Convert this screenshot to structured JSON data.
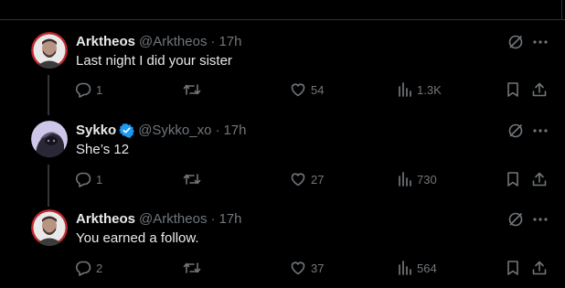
{
  "posts": [
    {
      "name": "Arktheos",
      "handle": "@Arktheos",
      "dot": "·",
      "time": "17h",
      "text": "Last night I did your sister",
      "verified": false,
      "replies": "1",
      "likes": "54",
      "views": "1.3K"
    },
    {
      "name": "Sykko",
      "handle": "@Sykko_xo",
      "dot": "·",
      "time": "17h",
      "text": "She’s 12",
      "verified": true,
      "replies": "1",
      "likes": "27",
      "views": "730"
    },
    {
      "name": "Arktheos",
      "handle": "@Arktheos",
      "dot": "·",
      "time": "17h",
      "text": "You earned a follow.",
      "verified": false,
      "replies": "2",
      "likes": "37",
      "views": "564"
    }
  ],
  "colors": {
    "background": "#000000",
    "text": "#e7e9ea",
    "muted": "#71767b",
    "verified": "#1d9bf0",
    "avatar_ring": "#c0282d"
  },
  "icons": [
    "reply-icon",
    "repost-icon",
    "like-icon",
    "views-icon",
    "bookmark-icon",
    "share-icon",
    "grok-icon",
    "more-icon",
    "verified-badge-icon"
  ]
}
